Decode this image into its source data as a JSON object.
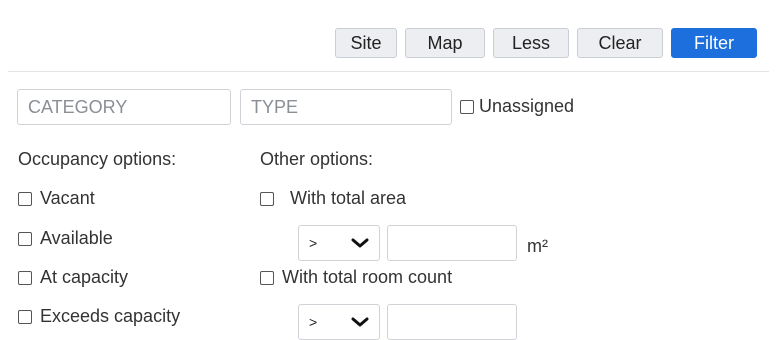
{
  "toolbar": {
    "site_label": "Site",
    "map_label": "Map",
    "less_label": "Less",
    "clear_label": "Clear",
    "filter_label": "Filter"
  },
  "filters": {
    "category_placeholder": "CATEGORY",
    "type_placeholder": "TYPE",
    "unassigned_label": "Unassigned"
  },
  "occupancy": {
    "heading": "Occupancy options:",
    "options": [
      "Vacant",
      "Available",
      "At capacity",
      "Exceeds capacity"
    ]
  },
  "other": {
    "heading": "Other options:",
    "total_area_label": "With total area",
    "area_operator": ">",
    "area_unit": "m²",
    "room_count_label": "With total room count",
    "room_operator": ">"
  },
  "colors": {
    "accent": "#1c6fdc",
    "button_bg": "#eceef1",
    "border": "#cfd3d7"
  }
}
